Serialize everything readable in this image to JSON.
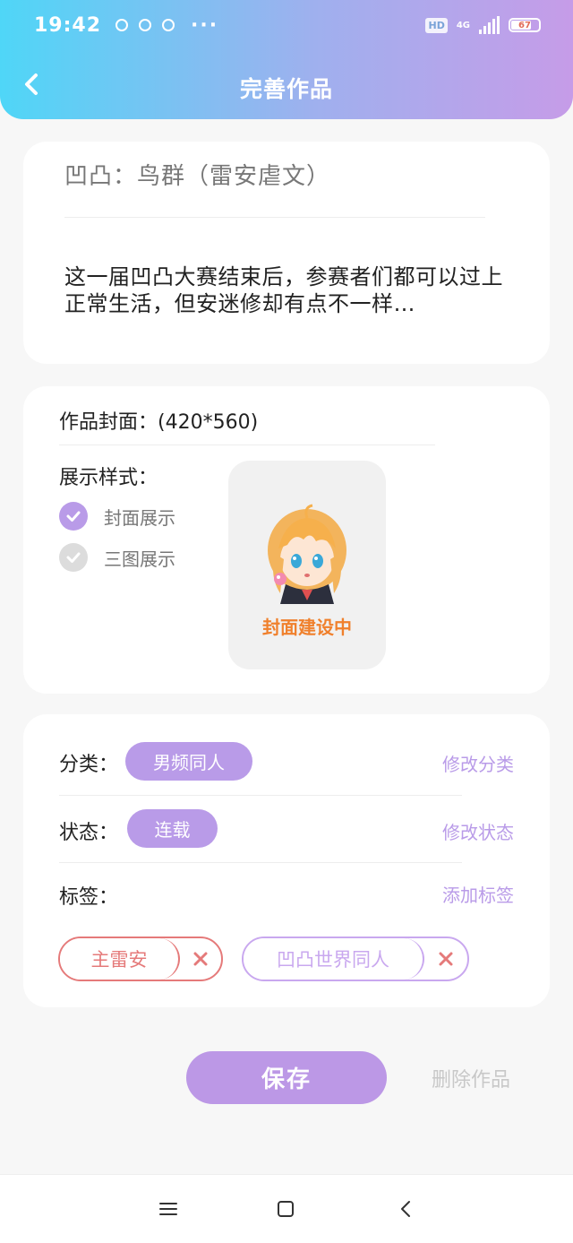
{
  "status_bar": {
    "time": "19:42",
    "more": "···",
    "hd": "HD",
    "network": "4G",
    "battery": "67"
  },
  "header": {
    "title": "完善作品"
  },
  "work": {
    "title": "凹凸：鸟群（雷安虐文）",
    "description": "这一届凹凸大赛结束后，参赛者们都可以过上正常生活，但安迷修却有点不一样…"
  },
  "cover": {
    "label": "作品封面：(420*560)",
    "display_style_label": "展示样式：",
    "options": [
      {
        "label": "封面展示",
        "checked": true
      },
      {
        "label": "三图展示",
        "checked": false
      }
    ],
    "placeholder_caption": "封面建设中"
  },
  "meta": {
    "category_label": "分类：",
    "category_value": "男频同人",
    "category_action": "修改分类",
    "status_label": "状态：",
    "status_value": "连载",
    "status_action": "修改状态",
    "tags_label": "标签：",
    "tags_action": "添加标签",
    "tags": [
      {
        "name": "主雷安",
        "color": "#e57a7a"
      },
      {
        "name": "凹凸世界同人",
        "color": "#c9a8ef"
      }
    ]
  },
  "actions": {
    "save": "保存",
    "delete": "删除作品"
  },
  "colors": {
    "accent": "#b99be8",
    "header_gradient_start": "#4fd6f7",
    "header_gradient_end": "#c69ce8",
    "cover_caption": "#f0802c"
  }
}
